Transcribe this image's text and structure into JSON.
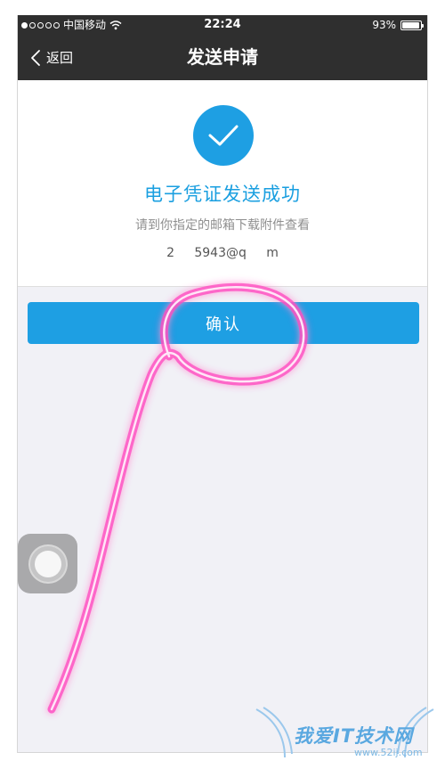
{
  "status_bar": {
    "carrier": "中国移动",
    "time": "22:24",
    "battery": "93%",
    "battery_level": 0.93,
    "signal_bars_filled": 1,
    "signal_bars_total": 5
  },
  "nav": {
    "back_label": "返回",
    "title": "发送申请"
  },
  "success": {
    "title": "电子凭证发送成功",
    "subtitle": "请到你指定的邮箱下载附件查看",
    "email_masked": "2        5943@q        m"
  },
  "confirm_button": {
    "label": "确认"
  },
  "watermark": {
    "text": "我爱IT技术网",
    "url": "www.52ij.com"
  },
  "colors": {
    "accent": "#1e9fe3",
    "nav_background": "#2f2f2f",
    "annotation": "#ff2fb4"
  },
  "icons": [
    "back-chevron-icon",
    "check-icon",
    "wifi-icon",
    "battery-icon"
  ]
}
